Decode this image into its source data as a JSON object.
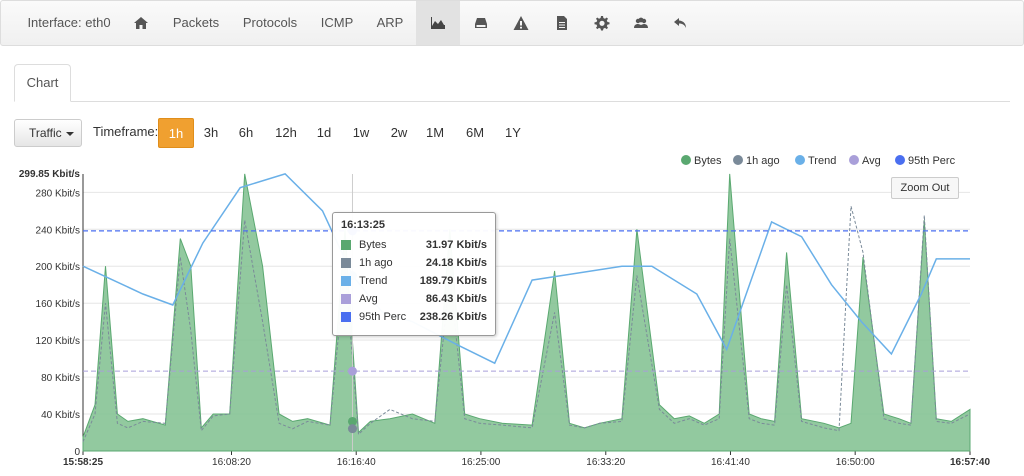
{
  "navbar": {
    "interface_label": "Interface: eth0",
    "items": [
      "Packets",
      "Protocols",
      "ICMP",
      "ARP"
    ],
    "icons": [
      "home-icon",
      "area-chart-icon",
      "hdd-icon",
      "warning-icon",
      "file-icon",
      "gear-icon",
      "users-icon",
      "undo-icon"
    ]
  },
  "tabs": {
    "chart": "Chart"
  },
  "toolbar": {
    "metric_dropdown": "Traffic",
    "timeframe_label": "Timeframe:",
    "timeframes": [
      "1h",
      "3h",
      "6h",
      "12h",
      "1d",
      "1w",
      "2w",
      "1M",
      "6M",
      "1Y"
    ],
    "active_timeframe": "1h"
  },
  "zoom_out": "Zoom Out",
  "colors": {
    "bytes": "#7fc08e",
    "bytes_line": "#5aa870",
    "ago": "#7a8a99",
    "trend": "#6ab0e8",
    "avg": "#a99fd9",
    "perc95": "#4a6ff0",
    "active_btn": "#f0a030"
  },
  "chart_data": {
    "type": "area",
    "y_max_label": "299.85 Kbit/s",
    "y_ticks": [
      "280 Kbit/s",
      "240 Kbit/s",
      "200 Kbit/s",
      "160 Kbit/s",
      "120 Kbit/s",
      "80 Kbit/s",
      "40 Kbit/s",
      "0"
    ],
    "y_tick_values": [
      280,
      240,
      200,
      160,
      120,
      80,
      40,
      0
    ],
    "ylim": [
      0,
      299.85
    ],
    "x_ticks": [
      "15:58:25",
      "16:08:20",
      "16:16:40",
      "16:25:00",
      "16:33:20",
      "16:41:40",
      "16:50:00",
      "16:57:40"
    ],
    "x_tick_positions": [
      0,
      9.92,
      18.25,
      26.58,
      34.92,
      43.25,
      51.58,
      59.25
    ],
    "xlim": [
      0,
      59.25
    ],
    "legend": [
      "Bytes",
      "1h ago",
      "Trend",
      "Avg",
      "95th Perc"
    ],
    "series": [
      {
        "name": "Bytes",
        "x": [
          0,
          0.8,
          1.5,
          2.3,
          3.0,
          4.0,
          5.5,
          6.5,
          7.2,
          7.9,
          8.7,
          9.8,
          10.8,
          12.0,
          13.1,
          14.0,
          15.0,
          16.5,
          17.5,
          18.4,
          19.2,
          20.5,
          22.0,
          23.5,
          24.5,
          25.5,
          26.5,
          28.0,
          30.0,
          31.5,
          32.5,
          33.5,
          34.5,
          36.0,
          37.0,
          38.5,
          39.5,
          40.5,
          41.5,
          42.5,
          43.2,
          44.5,
          45.3,
          46.2,
          47.0,
          48.0,
          49.5,
          50.5,
          51.3,
          52.1,
          53.5,
          54.5,
          55.3,
          56.2,
          57.0,
          58.0,
          59.25
        ],
        "values": [
          15,
          50,
          200,
          40,
          32,
          35,
          28,
          230,
          200,
          25,
          40,
          40,
          300,
          200,
          40,
          32,
          35,
          28,
          240,
          20,
          32,
          35,
          40,
          30,
          240,
          40,
          35,
          30,
          28,
          195,
          30,
          25,
          30,
          35,
          240,
          50,
          35,
          38,
          30,
          40,
          300,
          40,
          35,
          32,
          215,
          35,
          30,
          25,
          30,
          210,
          40,
          35,
          30,
          250,
          35,
          32,
          45
        ]
      },
      {
        "name": "1h ago",
        "x": [
          0,
          0.8,
          1.5,
          2.3,
          3.0,
          4.0,
          5.5,
          6.5,
          7.2,
          7.9,
          8.7,
          9.8,
          10.8,
          12.0,
          13.1,
          14.0,
          15.0,
          16.5,
          17.5,
          18.4,
          19.2,
          20.5,
          22.0,
          23.5,
          24.5,
          25.5,
          26.5,
          28.0,
          30.0,
          31.5,
          32.5,
          33.5,
          34.5,
          36.0,
          37.0,
          38.5,
          39.5,
          40.5,
          41.5,
          42.5,
          43.2,
          44.5,
          45.3,
          46.2,
          47.0,
          48.0,
          49.5,
          50.5,
          51.3,
          52.1,
          53.5,
          54.5,
          55.3,
          56.2,
          57.0,
          58.0,
          59.25
        ],
        "values": [
          10,
          40,
          160,
          30,
          25,
          32,
          30,
          210,
          130,
          22,
          38,
          40,
          250,
          140,
          30,
          24,
          32,
          28,
          200,
          18,
          30,
          45,
          35,
          32,
          190,
          35,
          30,
          28,
          25,
          150,
          28,
          25,
          30,
          32,
          190,
          45,
          30,
          35,
          28,
          35,
          230,
          35,
          30,
          28,
          180,
          32,
          25,
          22,
          265,
          215,
          35,
          30,
          28,
          255,
          32,
          30,
          40
        ]
      },
      {
        "name": "Trend",
        "x": [
          0,
          2.0,
          4.0,
          6.0,
          8.0,
          10.5,
          13.5,
          16.0,
          18.0,
          20.0,
          22.0,
          25.0,
          27.5,
          30.0,
          32.0,
          36.0,
          38.0,
          41.0,
          43.0,
          46.0,
          48.0,
          50.0,
          52.0,
          54.0,
          56.0,
          57.0,
          59.25
        ],
        "values": [
          200,
          185,
          170,
          158,
          225,
          285,
          300,
          260,
          190,
          150,
          140,
          115,
          95,
          185,
          190,
          200,
          200,
          170,
          110,
          248,
          232,
          180,
          140,
          105,
          170,
          208,
          208
        ]
      },
      {
        "name": "Avg",
        "constant": 86.43
      },
      {
        "name": "95th Perc",
        "constant": 238.26
      }
    ],
    "hover": {
      "x": 18.0,
      "time": "16:13:25",
      "rows": [
        {
          "name": "Bytes",
          "value": "31.97 Kbit/s",
          "num": 31.97
        },
        {
          "name": "1h ago",
          "value": "24.18 Kbit/s",
          "num": 24.18
        },
        {
          "name": "Trend",
          "value": "189.79 Kbit/s",
          "num": 189.79
        },
        {
          "name": "Avg",
          "value": "86.43 Kbit/s",
          "num": 86.43
        },
        {
          "name": "95th Perc",
          "value": "238.26 Kbit/s",
          "num": 238.26
        }
      ]
    }
  }
}
